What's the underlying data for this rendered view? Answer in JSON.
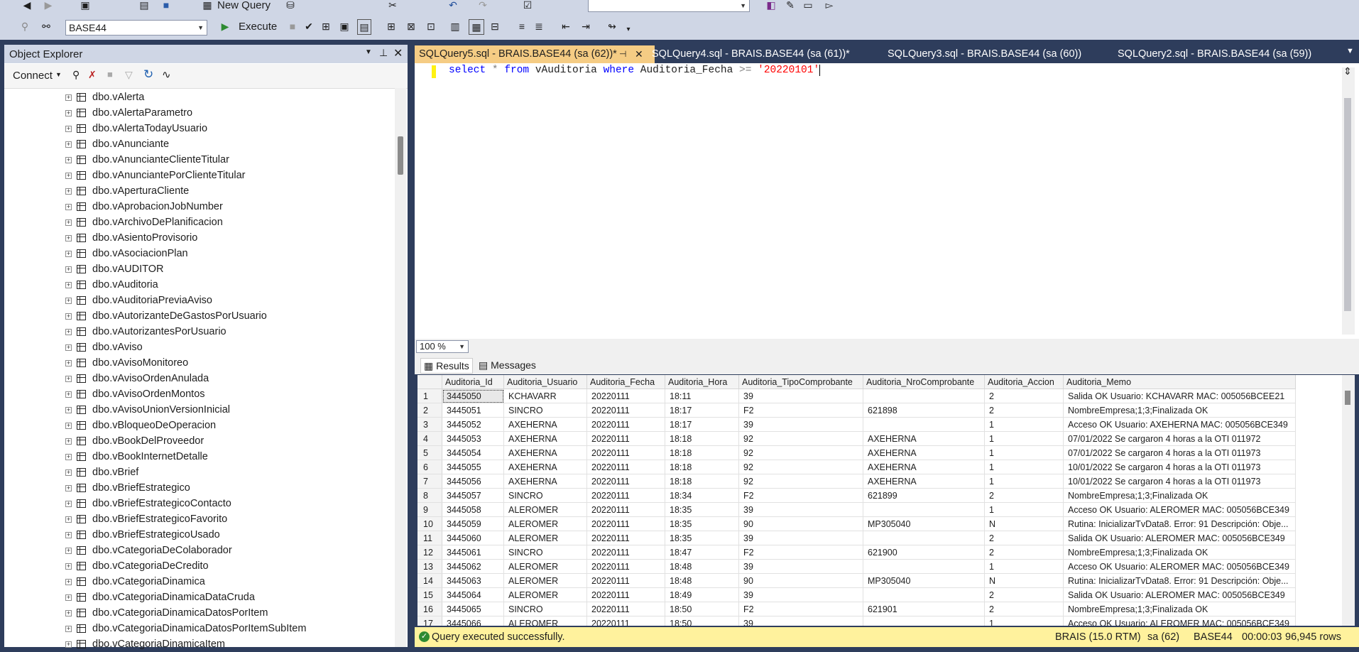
{
  "toolbar": {
    "new_query_label": "New Query",
    "database_selector": "BASE44",
    "execute_label": "Execute"
  },
  "object_explorer": {
    "title": "Object Explorer",
    "connect_label": "Connect",
    "items": [
      "dbo.vAlerta",
      "dbo.vAlertaParametro",
      "dbo.vAlertaTodayUsuario",
      "dbo.vAnunciante",
      "dbo.vAnuncianteClienteTitular",
      "dbo.vAnunciantePorClienteTitular",
      "dbo.vAperturaCliente",
      "dbo.vAprobacionJobNumber",
      "dbo.vArchivoDePlanificacion",
      "dbo.vAsientoProvisorio",
      "dbo.vAsociacionPlan",
      "dbo.vAUDITOR",
      "dbo.vAuditoria",
      "dbo.vAuditoriaPreviaAviso",
      "dbo.vAutorizanteDeGastosPorUsuario",
      "dbo.vAutorizantesPorUsuario",
      "dbo.vAviso",
      "dbo.vAvisoMonitoreo",
      "dbo.vAvisoOrdenAnulada",
      "dbo.vAvisoOrdenMontos",
      "dbo.vAvisoUnionVersionInicial",
      "dbo.vBloqueoDeOperacion",
      "dbo.vBookDelProveedor",
      "dbo.vBookInternetDetalle",
      "dbo.vBrief",
      "dbo.vBriefEstrategico",
      "dbo.vBriefEstrategicoContacto",
      "dbo.vBriefEstrategicoFavorito",
      "dbo.vBriefEstrategicoUsado",
      "dbo.vCategoriaDeColaborador",
      "dbo.vCategoriaDeCredito",
      "dbo.vCategoriaDinamica",
      "dbo.vCategoriaDinamicaDataCruda",
      "dbo.vCategoriaDinamicaDatosPorItem",
      "dbo.vCategoriaDinamicaDatosPorItemSubItem",
      "dbo.vCategoriaDinamicaItem"
    ]
  },
  "tabs": [
    {
      "label": "SQLQuery5.sql - BRAIS.BASE44 (sa (62))*"
    },
    {
      "label": "SQLQuery4.sql - BRAIS.BASE44 (sa (61))*"
    },
    {
      "label": "SQLQuery3.sql - BRAIS.BASE44 (sa (60))"
    },
    {
      "label": "SQLQuery2.sql - BRAIS.BASE44 (sa (59))"
    }
  ],
  "editor": {
    "kw_select": "select",
    "op_star": "*",
    "kw_from": "from",
    "ident1": "vAuditoria",
    "kw_where": "where",
    "ident2": "Auditoria_Fecha",
    "op_ge": ">=",
    "str": "'20220101'",
    "zoom": "100 %"
  },
  "results": {
    "results_tab": "Results",
    "messages_tab": "Messages",
    "columns": [
      "Auditoria_Id",
      "Auditoria_Usuario",
      "Auditoria_Fecha",
      "Auditoria_Hora",
      "Auditoria_TipoComprobante",
      "Auditoria_NroComprobante",
      "Auditoria_Accion",
      "Auditoria_Memo"
    ],
    "rows": [
      [
        "1",
        "3445050",
        "KCHAVARR",
        "20220111",
        "18:11",
        "39",
        "",
        "2",
        "Salida OK  Usuario: KCHAVARR  MAC: 005056BCEE21"
      ],
      [
        "2",
        "3445051",
        "SINCRO",
        "20220111",
        "18:17",
        "F2",
        "621898",
        "2",
        "NombreEmpresa;1;3;Finalizada OK"
      ],
      [
        "3",
        "3445052",
        "AXEHERNA",
        "20220111",
        "18:17",
        "39",
        "",
        "1",
        "Acceso OK  Usuario: AXEHERNA  MAC: 005056BCE349"
      ],
      [
        "4",
        "3445053",
        "AXEHERNA",
        "20220111",
        "18:18",
        "92",
        "AXEHERNA",
        "1",
        "07/01/2022 Se cargaron 4 horas a la OTI 011972"
      ],
      [
        "5",
        "3445054",
        "AXEHERNA",
        "20220111",
        "18:18",
        "92",
        "AXEHERNA",
        "1",
        "07/01/2022 Se cargaron 4 horas a la OTI 011973"
      ],
      [
        "6",
        "3445055",
        "AXEHERNA",
        "20220111",
        "18:18",
        "92",
        "AXEHERNA",
        "1",
        "10/01/2022 Se cargaron 4 horas a la OTI 011973"
      ],
      [
        "7",
        "3445056",
        "AXEHERNA",
        "20220111",
        "18:18",
        "92",
        "AXEHERNA",
        "1",
        "10/01/2022 Se cargaron 4 horas a la OTI 011973"
      ],
      [
        "8",
        "3445057",
        "SINCRO",
        "20220111",
        "18:34",
        "F2",
        "621899",
        "2",
        "NombreEmpresa;1;3;Finalizada OK"
      ],
      [
        "9",
        "3445058",
        "ALEROMER",
        "20220111",
        "18:35",
        "39",
        "",
        "1",
        "Acceso OK  Usuario: ALEROMER  MAC: 005056BCE349"
      ],
      [
        "10",
        "3445059",
        "ALEROMER",
        "20220111",
        "18:35",
        "90",
        "MP305040",
        "N",
        "Rutina: InicializarTvData8.  Error: 91  Descripción: Obje..."
      ],
      [
        "11",
        "3445060",
        "ALEROMER",
        "20220111",
        "18:35",
        "39",
        "",
        "2",
        "Salida OK  Usuario: ALEROMER  MAC: 005056BCE349"
      ],
      [
        "12",
        "3445061",
        "SINCRO",
        "20220111",
        "18:47",
        "F2",
        "621900",
        "2",
        "NombreEmpresa;1;3;Finalizada OK"
      ],
      [
        "13",
        "3445062",
        "ALEROMER",
        "20220111",
        "18:48",
        "39",
        "",
        "1",
        "Acceso OK  Usuario: ALEROMER  MAC: 005056BCE349"
      ],
      [
        "14",
        "3445063",
        "ALEROMER",
        "20220111",
        "18:48",
        "90",
        "MP305040",
        "N",
        "Rutina: InicializarTvData8.  Error: 91  Descripción: Obje..."
      ],
      [
        "15",
        "3445064",
        "ALEROMER",
        "20220111",
        "18:49",
        "39",
        "",
        "2",
        "Salida OK  Usuario: ALEROMER  MAC: 005056BCE349"
      ],
      [
        "16",
        "3445065",
        "SINCRO",
        "20220111",
        "18:50",
        "F2",
        "621901",
        "2",
        "NombreEmpresa;1;3;Finalizada OK"
      ],
      [
        "17",
        "3445066",
        "ALEROMER",
        "20220111",
        "18:50",
        "39",
        "",
        "1",
        "Acceso OK  Usuario: ALEROMER  MAC: 005056BCE349"
      ]
    ]
  },
  "status": {
    "message": "Query executed successfully.",
    "server": "BRAIS (15.0 RTM)",
    "user": "sa (62)",
    "database": "BASE44",
    "elapsed": "00:00:03",
    "rows": "96,945 rows"
  },
  "colors": {
    "chrome": "#cfd6e5",
    "background": "#2e3d5c",
    "active_tab": "#f5cc84",
    "status_bar": "#fff29d",
    "keyword": "#0000ff",
    "string": "#ff0000"
  }
}
